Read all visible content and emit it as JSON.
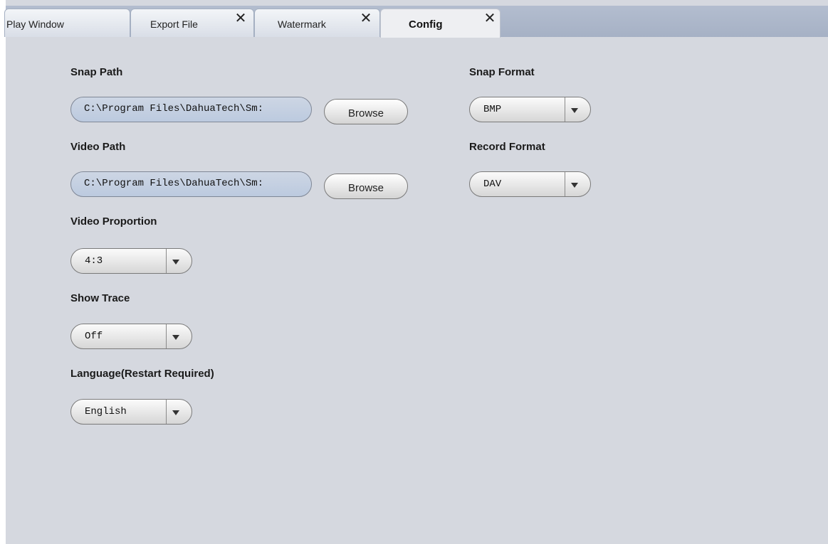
{
  "tabs": [
    {
      "label": "Play Window",
      "closable": false,
      "active": false
    },
    {
      "label": "Export File",
      "closable": true,
      "active": false
    },
    {
      "label": "Watermark",
      "closable": true,
      "active": false
    },
    {
      "label": "Config",
      "closable": true,
      "active": true
    }
  ],
  "close_glyph": "✕",
  "config": {
    "snap_path": {
      "label": "Snap Path",
      "value": "C:\\Program Files\\DahuaTech\\Sm:",
      "browse_label": "Browse"
    },
    "video_path": {
      "label": "Video Path",
      "value": "C:\\Program Files\\DahuaTech\\Sm:",
      "browse_label": "Browse"
    },
    "video_proportion": {
      "label": "Video Proportion",
      "value": "4:3"
    },
    "show_trace": {
      "label": "Show Trace",
      "value": "Off"
    },
    "language": {
      "label": "Language(Restart Required)",
      "value": "English"
    },
    "snap_format": {
      "label": "Snap Format",
      "value": "BMP"
    },
    "record_format": {
      "label": "Record Format",
      "value": "DAV"
    }
  },
  "icons": {
    "dropdown": "chevron-down-icon",
    "close": "close-icon"
  }
}
